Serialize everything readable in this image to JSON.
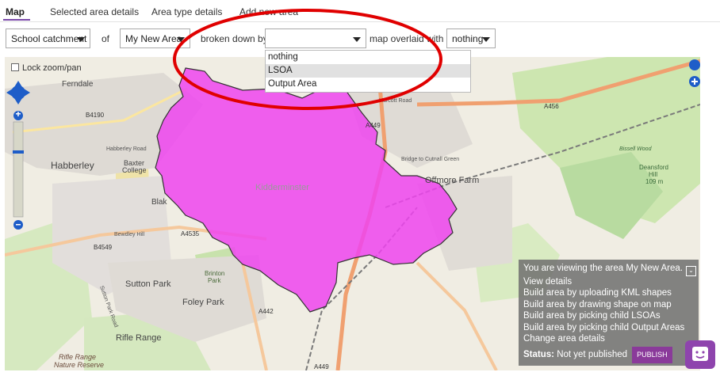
{
  "tabs": [
    "Map",
    "Selected area details",
    "Area type details",
    "Add new area"
  ],
  "controls": {
    "area_type": "School catchment",
    "of_label": "of",
    "area": "My New Area",
    "broken_down_label": "broken down by",
    "breakdown_value": "",
    "overlaid_label": "map overlaid with",
    "overlay": "nothing"
  },
  "dropdown_options": [
    "nothing",
    "LSOA",
    "Output Area"
  ],
  "map": {
    "lock_label": "Lock zoom/pan",
    "places": {
      "ferndale": "Ferndale",
      "habberley": "Habberley",
      "habberley_road": "Habberley Road",
      "baxter": "Baxter",
      "college": "College",
      "kidderminster": "Kidderminster",
      "offmore_farm": "Offmore Farm",
      "sutton_park": "Sutton Park",
      "foley_park": "Foley Park",
      "brinton": "Brinton",
      "park": "Park",
      "rifle_range": "Rifle Range",
      "rifle_range_nature": "Rifle Range",
      "nature_reserve": "Nature Reserve",
      "bissell_wood": "Bissell Wood",
      "deansford": "Deansford",
      "hill": "Hill",
      "elev": "109 m",
      "hurcott_road": "Hurcott Road",
      "blak": "Blak",
      "cutnall": "Bridge to Cutnall Green",
      "bewdley_hill": "Bewdley Hill",
      "sutton_park_road": "Sutton Park Road"
    },
    "roads": {
      "b4190": "B4190",
      "a449": "A449",
      "a456": "A456",
      "a4535": "A4535",
      "b4549": "B4549",
      "a442": "A442",
      "a449_bottom": "A449"
    }
  },
  "info": {
    "viewing": "You are viewing the area My New Area.",
    "links": [
      "View details",
      "Build area by uploading KML shapes",
      "Build area by drawing shape on map",
      "Build area by picking child LSOAs",
      "Build area by picking child Output Areas",
      "Change area details"
    ],
    "status_label": "Status:",
    "status_value": "Not yet published",
    "publish": "PUBLISH"
  },
  "colors": {
    "accent": "#8e44ad",
    "area_fill": "#ee44ee",
    "annotation": "#e00000"
  }
}
